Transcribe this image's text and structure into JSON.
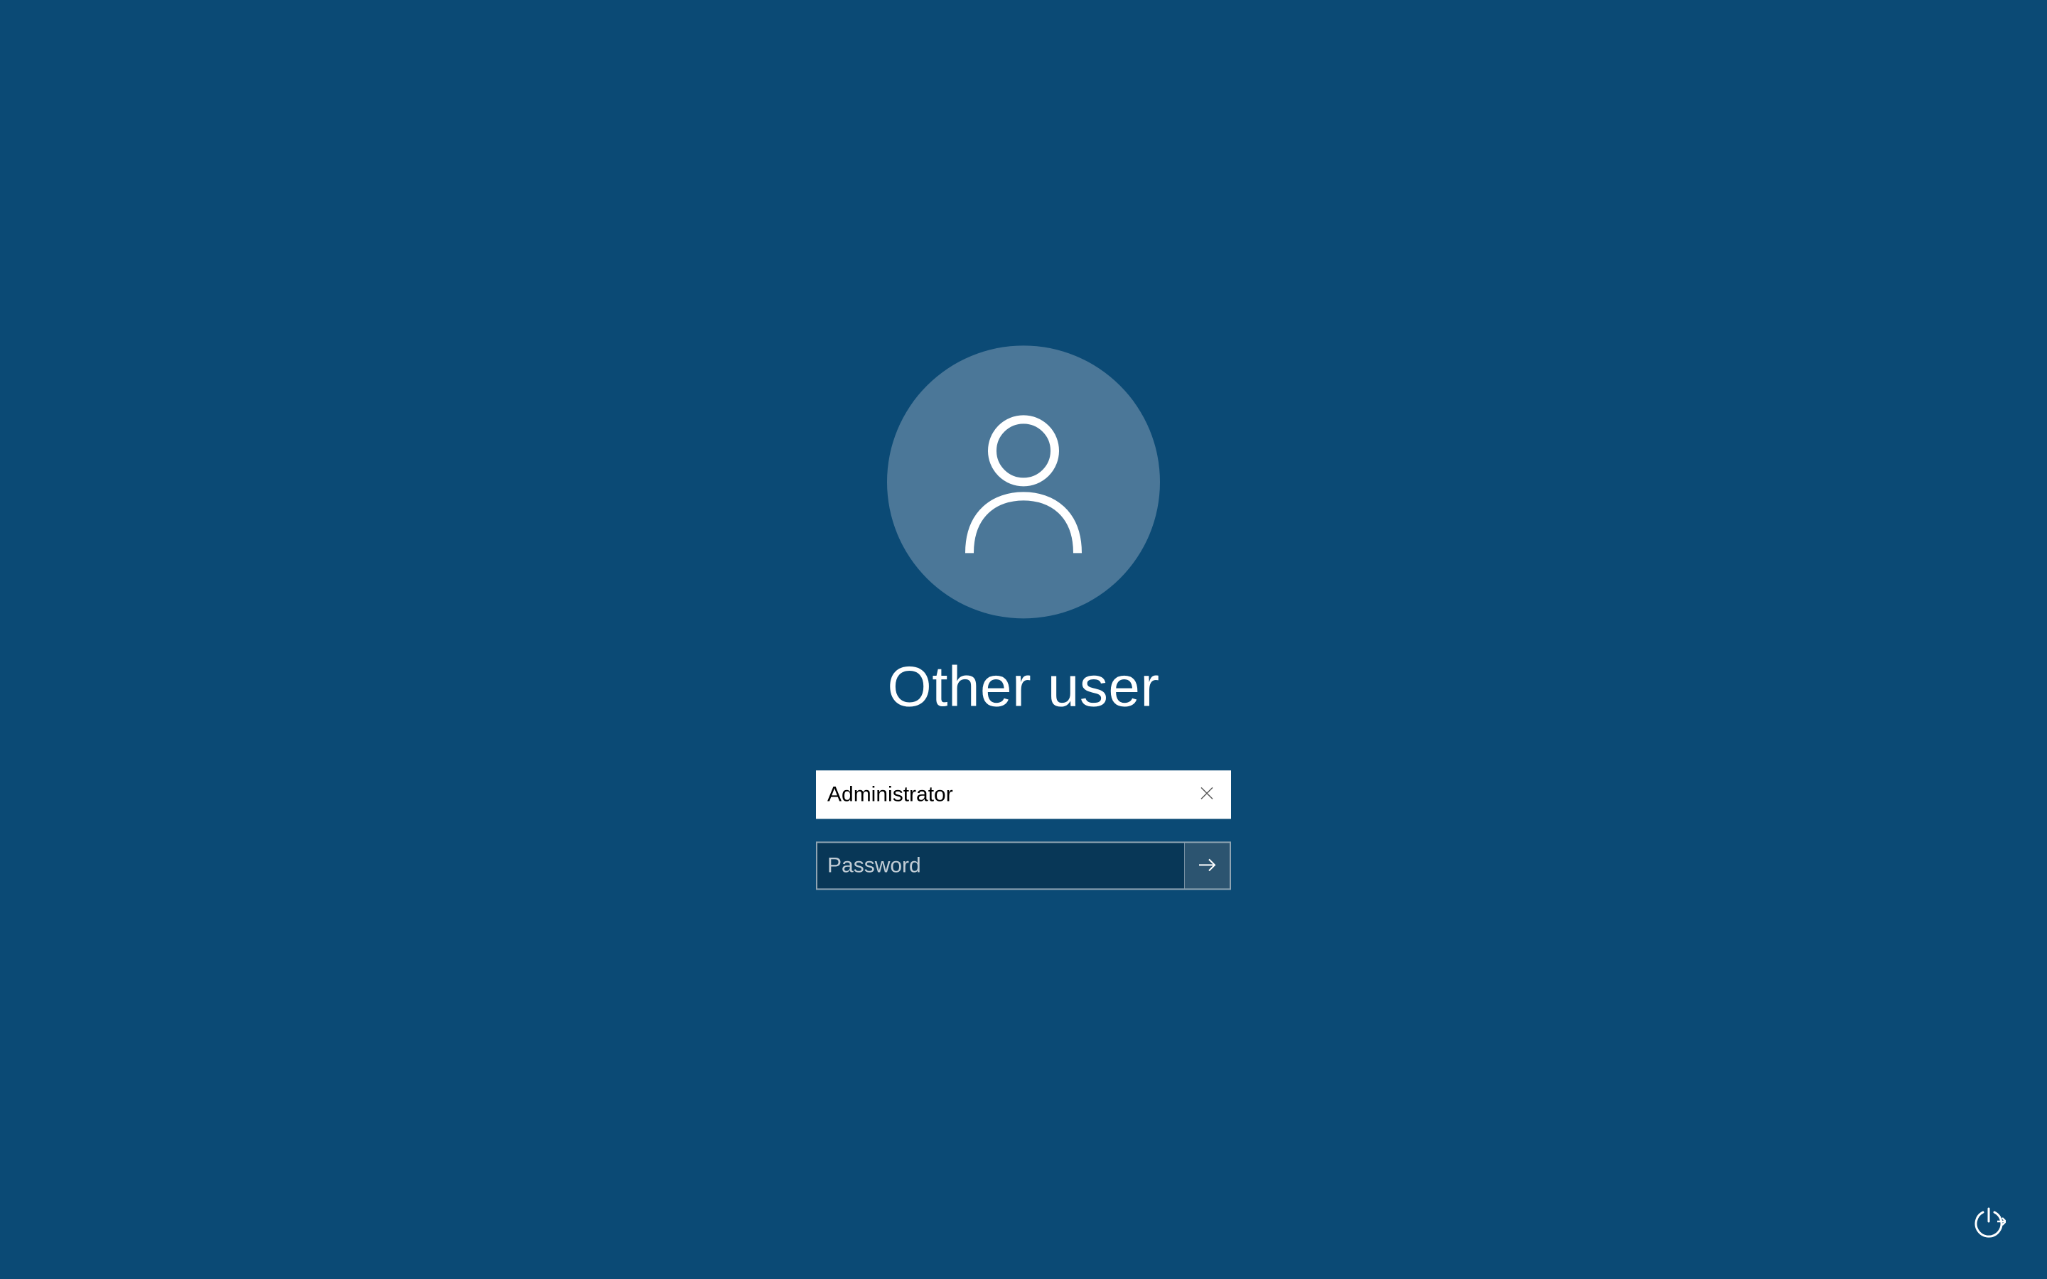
{
  "login": {
    "title": "Other user",
    "username_value": "Administrator",
    "password_placeholder": "Password",
    "password_value": ""
  }
}
